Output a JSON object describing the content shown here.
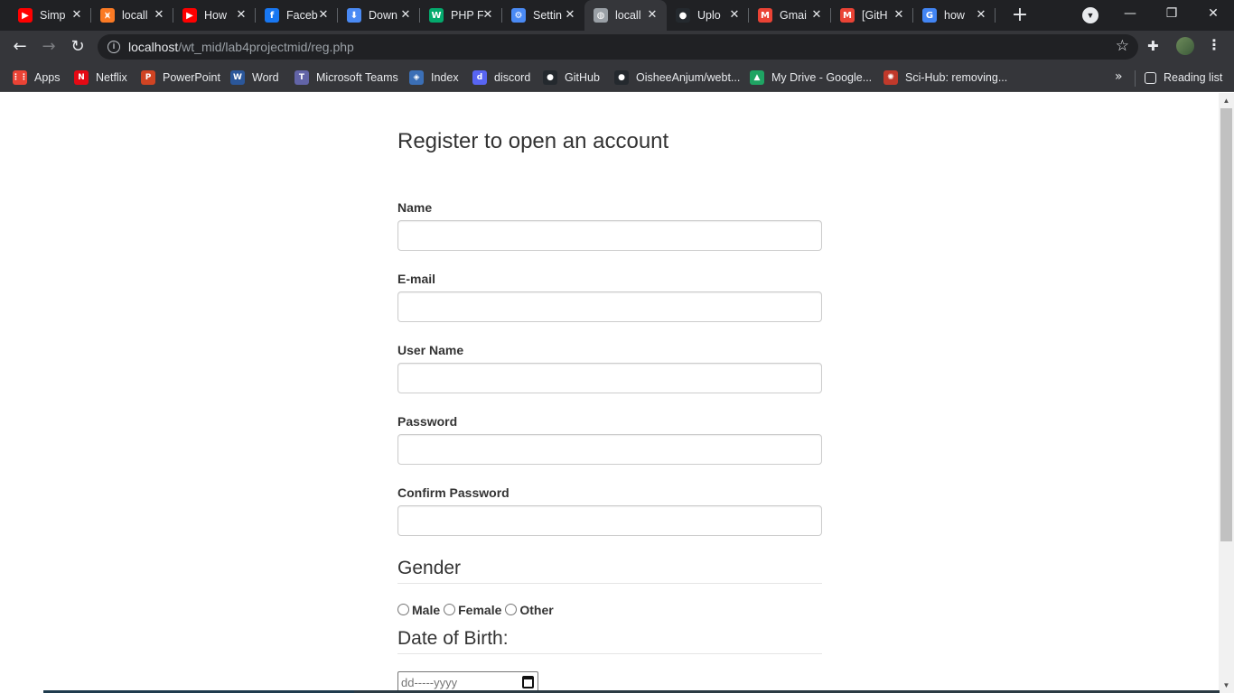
{
  "browser": {
    "tabs": [
      {
        "title": "Simp",
        "icon": "youtube-icon",
        "color": "#ff0000",
        "glyph": "▶"
      },
      {
        "title": "locall",
        "icon": "xampp-icon",
        "color": "#fb7a24",
        "glyph": "⩙"
      },
      {
        "title": "How",
        "icon": "youtube-icon",
        "color": "#ff0000",
        "glyph": "▶"
      },
      {
        "title": "Faceb",
        "icon": "facebook-icon",
        "color": "#1877f2",
        "glyph": "f"
      },
      {
        "title": "Down",
        "icon": "download-icon",
        "color": "#4a8af4",
        "glyph": "⬇"
      },
      {
        "title": "PHP F",
        "icon": "w3schools-icon",
        "color": "#04aa6d",
        "glyph": "W"
      },
      {
        "title": "Settin",
        "icon": "settings-gear-icon",
        "color": "#4a8af4",
        "glyph": "⚙"
      },
      {
        "title": "locall",
        "icon": "globe-icon",
        "color": "#9aa0a6",
        "glyph": "◍"
      },
      {
        "title": "Uplo",
        "icon": "github-icon",
        "color": "#24292e",
        "glyph": "●"
      },
      {
        "title": "Gmai",
        "icon": "gmail-icon",
        "color": "#ea4335",
        "glyph": "M"
      },
      {
        "title": "[GitH",
        "icon": "gmail-icon",
        "color": "#ea4335",
        "glyph": "M"
      },
      {
        "title": "how",
        "icon": "google-icon",
        "color": "#4285f4",
        "glyph": "G"
      }
    ],
    "active_tab": 7,
    "url_host": "localhost",
    "url_path": "/wt_mid/lab4projectmid/reg.php",
    "bookmarks": [
      {
        "label": "Apps",
        "icon": "apps-grid-icon",
        "color": "#ea4335",
        "glyph": "⋮⋮"
      },
      {
        "label": "Netflix",
        "icon": "netflix-icon",
        "color": "#e50914",
        "glyph": "N"
      },
      {
        "label": "PowerPoint",
        "icon": "powerpoint-icon",
        "color": "#d04423",
        "glyph": "P"
      },
      {
        "label": "Word",
        "icon": "word-icon",
        "color": "#2b579a",
        "glyph": "W"
      },
      {
        "label": "Microsoft Teams",
        "icon": "teams-icon",
        "color": "#6264a7",
        "glyph": "T"
      },
      {
        "label": "Index",
        "icon": "shield-icon",
        "color": "#3b6fb6",
        "glyph": "◈"
      },
      {
        "label": "discord",
        "icon": "discord-icon",
        "color": "#5865f2",
        "glyph": "d"
      },
      {
        "label": "GitHub",
        "icon": "github-icon",
        "color": "#24292e",
        "glyph": "●"
      },
      {
        "label": "OisheeAnjum/webt...",
        "icon": "github-icon",
        "color": "#24292e",
        "glyph": "●"
      },
      {
        "label": "My Drive - Google...",
        "icon": "google-drive-icon",
        "color": "#1fa463",
        "glyph": "▲"
      },
      {
        "label": "Sci-Hub: removing...",
        "icon": "scihub-icon",
        "color": "#c0392b",
        "glyph": "✺"
      }
    ],
    "more_bookmarks": "»",
    "reading_list": "Reading list"
  },
  "form": {
    "title": "Register to open an account",
    "name_label": "Name",
    "email_label": "E-mail",
    "username_label": "User Name",
    "password_label": "Password",
    "confirm_password_label": "Confirm Password",
    "gender_legend": "Gender",
    "gender_options": [
      "Male",
      "Female",
      "Other"
    ],
    "dob_legend": "Date of Birth:",
    "dob_placeholder": "dd-----yyyy"
  }
}
